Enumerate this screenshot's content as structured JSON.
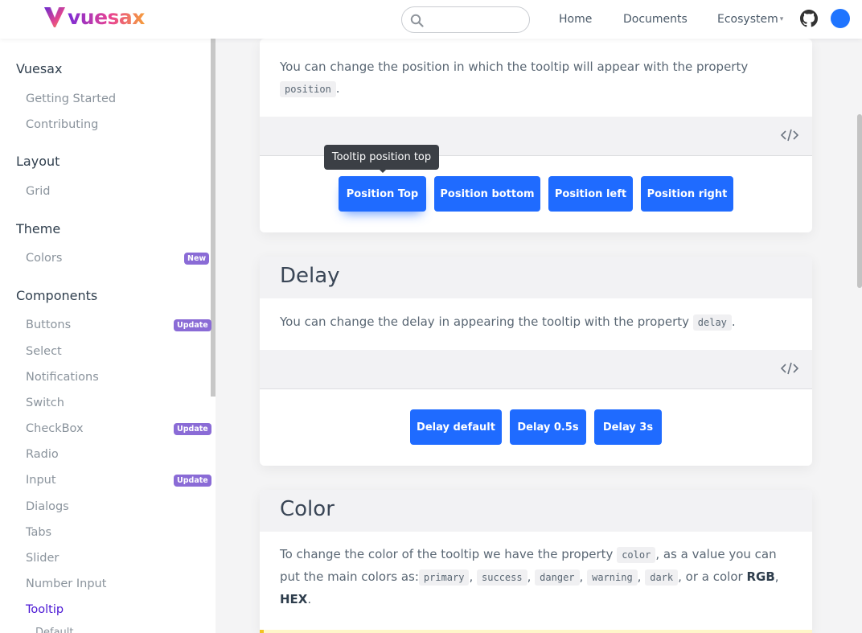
{
  "header": {
    "logo_text": "vuesax",
    "search_placeholder": "",
    "nav": [
      {
        "label": "Home"
      },
      {
        "label": "Documents"
      },
      {
        "label": "Ecosystem"
      }
    ],
    "ecosystem_caret": "▾"
  },
  "sidebar": {
    "groups": [
      {
        "title": "Vuesax",
        "items": [
          {
            "label": "Getting Started"
          },
          {
            "label": "Contributing"
          }
        ]
      },
      {
        "title": "Layout",
        "items": [
          {
            "label": "Grid"
          }
        ]
      },
      {
        "title": "Theme",
        "items": [
          {
            "label": "Colors",
            "badge": "New"
          }
        ]
      },
      {
        "title": "Components",
        "items": [
          {
            "label": "Buttons",
            "badge": "Update"
          },
          {
            "label": "Select"
          },
          {
            "label": "Notifications"
          },
          {
            "label": "Switch"
          },
          {
            "label": "CheckBox",
            "badge": "Update"
          },
          {
            "label": "Radio"
          },
          {
            "label": "Input",
            "badge": "Update"
          },
          {
            "label": "Dialogs"
          },
          {
            "label": "Tabs"
          },
          {
            "label": "Slider"
          },
          {
            "label": "Number Input"
          },
          {
            "label": "Tooltip",
            "active": true
          },
          {
            "label": "Default"
          }
        ]
      }
    ]
  },
  "position_section": {
    "text_before": "You can change the position in which the tooltip will appear with the property",
    "code": "position",
    "text_after": ".",
    "tooltip_text": "Tooltip position top",
    "buttons": [
      {
        "label": "Position Top"
      },
      {
        "label": "Position bottom"
      },
      {
        "label": "Position left"
      },
      {
        "label": "Position right"
      }
    ]
  },
  "delay_section": {
    "title": "Delay",
    "text_before": "You can change the delay in appearing the tooltip with the property",
    "code": "delay",
    "text_after": ".",
    "buttons": [
      {
        "label": "Delay default"
      },
      {
        "label": "Delay 0.5s"
      },
      {
        "label": "Delay 3s"
      }
    ]
  },
  "color_section": {
    "title": "Color",
    "line1_text": "To change the color of the tooltip we have the property",
    "line1_code": "color",
    "line1_after": ", as a value you can",
    "line2_text": "put the main colors as:",
    "colors": [
      "primary",
      "success",
      "danger",
      "warning",
      "dark"
    ],
    "sep": ",",
    "line2_after": ", or a color",
    "rgb": "RGB",
    "comma": ",",
    "hex": "HEX",
    "period": "."
  },
  "colors": {
    "primary": "#1f6bff",
    "active_nav": "#4a16d4",
    "badge": "#8a6bd6",
    "tooltip_bg": "#3b3f45"
  }
}
